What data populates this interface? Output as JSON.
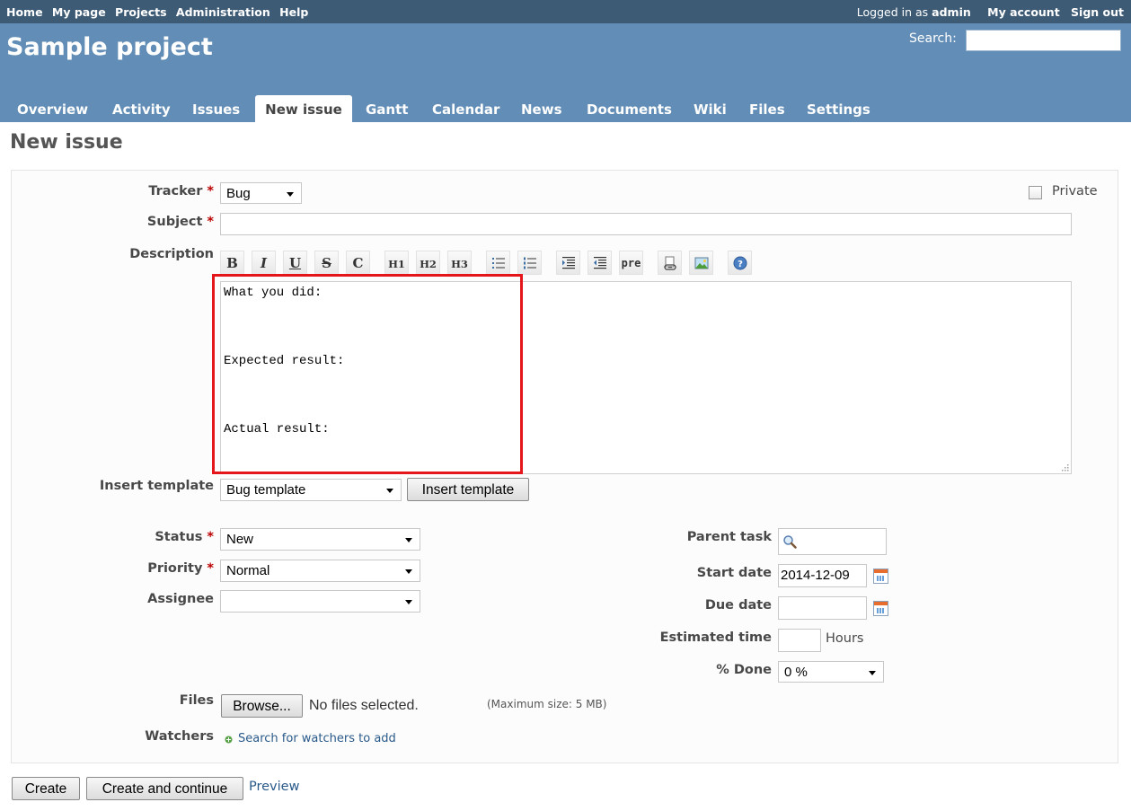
{
  "top_menu": {
    "items": [
      "Home",
      "My page",
      "Projects",
      "Administration",
      "Help"
    ],
    "logged_in_prefix": "Logged in as",
    "user": "admin",
    "my_account": "My account",
    "sign_out": "Sign out"
  },
  "header": {
    "project_title": "Sample project",
    "search_label": "Search:",
    "search_value": ""
  },
  "tabs": [
    "Overview",
    "Activity",
    "Issues",
    "New issue",
    "Gantt",
    "Calendar",
    "News",
    "Documents",
    "Wiki",
    "Files",
    "Settings"
  ],
  "selected_tab": "New issue",
  "page_title": "New issue",
  "form": {
    "tracker_label": "Tracker",
    "tracker_value": "Bug",
    "private_label": "Private",
    "subject_label": "Subject",
    "subject_value": "",
    "description_label": "Description",
    "toolbar": {
      "bold": "B",
      "italic": "I",
      "underline": "U",
      "strike": "S",
      "code": "C",
      "h1": "H1",
      "h2": "H2",
      "h3": "H3",
      "pre": "pre",
      "icons": [
        "bold-icon",
        "italic-icon",
        "underline-icon",
        "strikethrough-icon",
        "inline-code-icon",
        "heading1-icon",
        "heading2-icon",
        "heading3-icon",
        "bullet-list-icon",
        "numbered-list-icon",
        "indent-icon",
        "outdent-icon",
        "preformatted-icon",
        "link-icon",
        "image-icon",
        "help-icon"
      ]
    },
    "description_lines": [
      "What you did:",
      "Expected result:",
      "Actual result:"
    ],
    "insert_template_label": "Insert template",
    "template_value": "Bug template",
    "insert_template_button": "Insert template",
    "status_label": "Status",
    "status_value": "New",
    "priority_label": "Priority",
    "priority_value": "Normal",
    "assignee_label": "Assignee",
    "assignee_value": "",
    "parent_task_label": "Parent task",
    "parent_task_value": "",
    "start_date_label": "Start date",
    "start_date_value": "2014-12-09",
    "due_date_label": "Due date",
    "due_date_value": "",
    "estimated_time_label": "Estimated time",
    "estimated_time_value": "",
    "hours_label": "Hours",
    "done_label": "% Done",
    "done_value": "0 %",
    "files_label": "Files",
    "browse_button": "Browse...",
    "no_files": "No files selected.",
    "max_size": "(Maximum size: 5 MB)",
    "watchers_label": "Watchers",
    "watchers_link": "Search for watchers to add"
  },
  "actions": {
    "create": "Create",
    "create_continue": "Create and continue",
    "preview": "Preview"
  },
  "colors": {
    "top_bar": "#3e5b76",
    "header": "#628db6",
    "required": "#bb0000",
    "link": "#2a5a8a",
    "highlight_box": "#e4161c"
  }
}
